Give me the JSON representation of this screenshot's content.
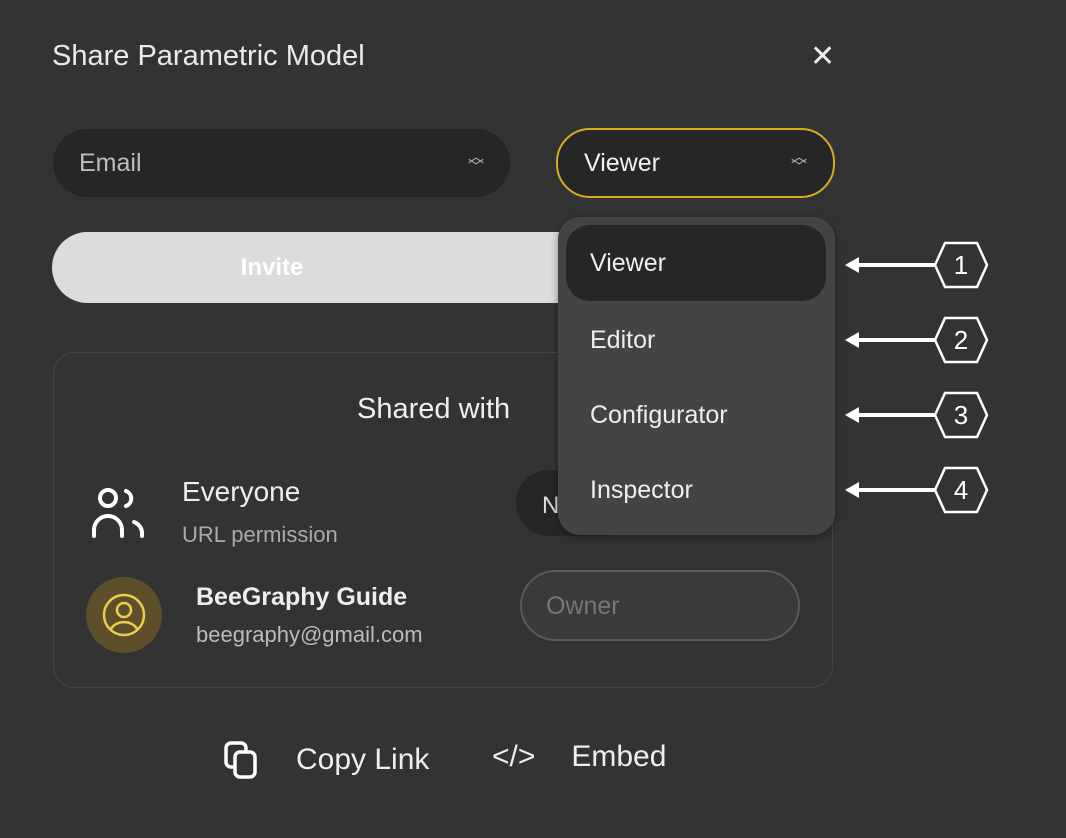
{
  "dialog": {
    "title": "Share Parametric Model",
    "close_icon": "close-icon"
  },
  "invite_form": {
    "email_placeholder": "Email",
    "role_value": "Viewer",
    "invite_label": "Invite",
    "accent": "#d6ac25"
  },
  "role_menu": {
    "items": [
      {
        "label": "Viewer",
        "selected": true
      },
      {
        "label": "Editor"
      },
      {
        "label": "Configurator"
      },
      {
        "label": "Inspector"
      }
    ]
  },
  "annotations": [
    "1",
    "2",
    "3",
    "4"
  ],
  "shared": {
    "heading": "Shared with",
    "everyone": {
      "name": "Everyone",
      "subtitle": "URL permission",
      "select_visible": "N"
    },
    "user": {
      "name": "BeeGraphy Guide",
      "email": "beegraphy@gmail.com",
      "role": "Owner"
    }
  },
  "footer": {
    "copy_link": "Copy Link",
    "embed": "Embed"
  }
}
